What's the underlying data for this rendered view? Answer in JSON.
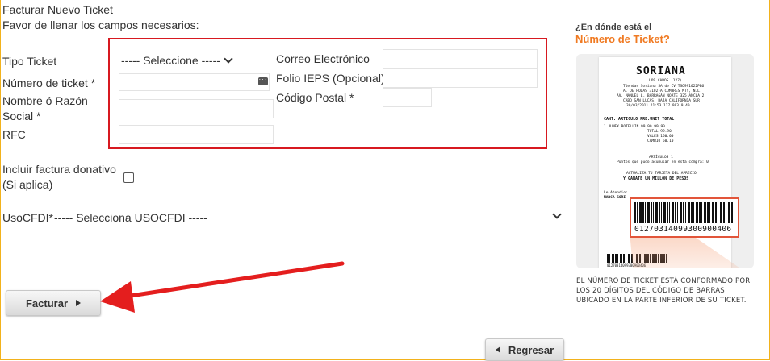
{
  "form": {
    "title": "Facturar Nuevo Ticket",
    "subtitle": "Favor de llenar los campos necesarios:",
    "tipo_ticket_label": "Tipo Ticket",
    "tipo_ticket_value": "----- Seleccione -----",
    "numero_ticket_label": "Número de ticket *",
    "nombre_label_line1": "Nombre ó Razón",
    "nombre_label_line2": "Social *",
    "rfc_label": "RFC",
    "correo_label": "Correo Electrónico",
    "folio_label": "Folio IEPS (Opcional)",
    "codigo_postal_label": "Código Postal *",
    "donativo_label_line1": "Incluir factura donativo",
    "donativo_label_line2": "(Si aplica)",
    "uso_cfdi_label": "UsoCFDI*",
    "uso_cfdi_value": "----- Selecciona USOCFDI -----"
  },
  "buttons": {
    "facturar": "Facturar",
    "regresar": "Regresar"
  },
  "help": {
    "question": "¿En dónde está el",
    "title": "Número de Ticket?",
    "note": "EL NÚMERO DE TICKET ESTÁ CONFORMADO POR LOS 20 DÍGITOS DEL CÓDIGO DE BARRAS UBICADO EN LA PARTE INFERIOR DE SU TICKET."
  },
  "receipt": {
    "brand": "SORIANA",
    "store": "LOS CABOS (127)",
    "line1": "Tiendas Soriana SA de CV TSO991022PB6",
    "line2": "A. DE RODAS 3102-A CUMBRES MTY, N.L.",
    "line3": "AV. MANUEL L. BARRAGÁN NORTE 325 ANCLA 2",
    "line4": "CABO SAN LUCAS, BAJA CALIFORNIA SUR",
    "line5": "30/03/2011 21:53 127 993 9 40",
    "header": "CANT. ARTICULO        PRE.UNIT  TOTAL",
    "item": "1     JUMEX BOTELLIN      99.90   99.90",
    "total": "TOTAL   99.90",
    "vales": "VALES  150.00",
    "cambio": "CAMBIO  50.10",
    "articulos": "ARTÍCULOS 1",
    "puntos": "Puntos que pudo acumular en esta compra: 0",
    "promo1": "ACTUALIZA TU TARJETA DEL APRECIO",
    "promo2": "Y GANATE UN MILLON DE PESOS",
    "atendio": "Le Atendio:",
    "marca": "MARCA SORI",
    "barcode_number": "01270314099300900406",
    "barcode_small": "01270314099300900406"
  },
  "colors": {
    "accent_border": "#f2b21c",
    "red_highlight": "#d71920",
    "help_orange": "#f07a22"
  }
}
